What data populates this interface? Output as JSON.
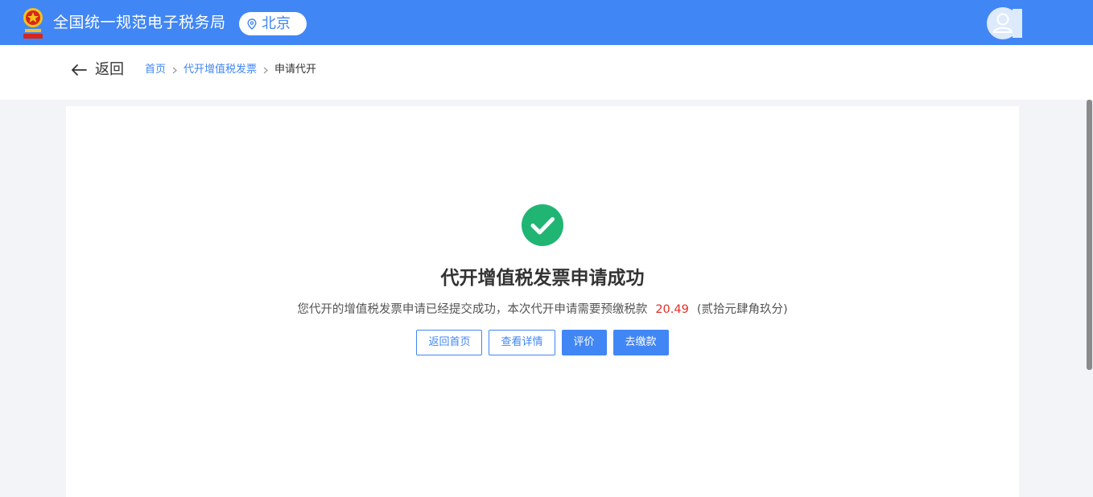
{
  "header": {
    "title": "全国统一规范电子税务局",
    "location": "北京",
    "emblem_icon": "tax-emblem-icon",
    "avatar_icon": "user-avatar-icon",
    "brand_color": "#4186f5"
  },
  "nav": {
    "back_label": "返回",
    "breadcrumb": {
      "home": "首页",
      "section": "代开增值税发票",
      "current": "申请代开"
    }
  },
  "result": {
    "status_icon": "success-check-icon",
    "status_color": "#21b573",
    "title": "代开增值税发票申请成功",
    "desc_prefix": "您代开的增值税发票申请已经提交成功，本次代开申请需要预缴税款",
    "amount": "20.49",
    "amount_color": "#e02e24",
    "amount_words": "(贰拾元肆角玖分)",
    "buttons": {
      "home": "返回首页",
      "details": "查看详情",
      "evaluate": "评价",
      "pay": "去缴款"
    }
  }
}
